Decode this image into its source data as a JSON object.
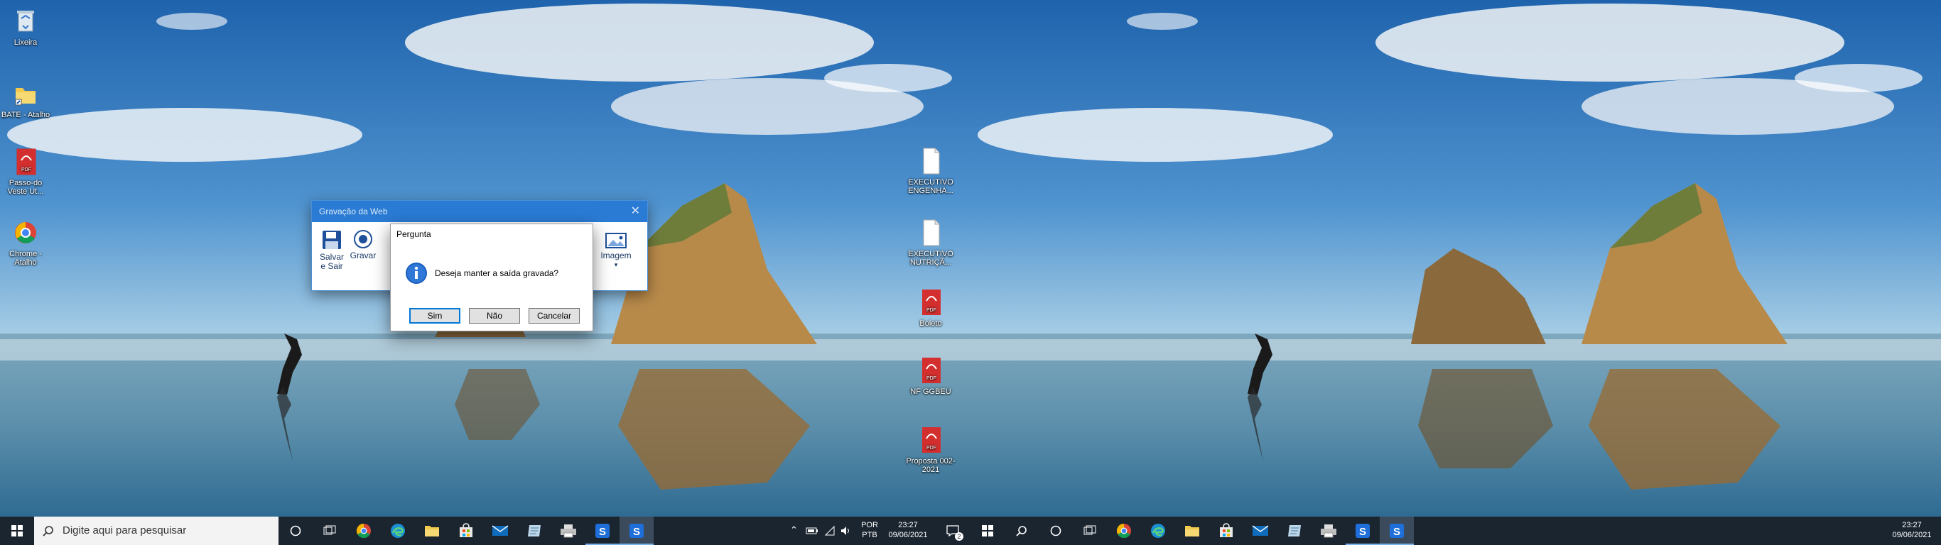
{
  "left_desktop": {
    "icons": [
      {
        "label": "Lixeira",
        "icon": "recycle-bin-icon"
      },
      {
        "label": "BATE - Atalho",
        "icon": "folder-shortcut-icon"
      },
      {
        "label": "Passo-do Veste Ut...",
        "icon": "pdf-file-icon"
      },
      {
        "label": "Chrome - Atalho",
        "icon": "chrome-icon"
      },
      {
        "label": "EXECUTIVO ENGENHA...",
        "icon": "blank-file-icon"
      },
      {
        "label": "EXECUTIVO NUTRIÇÃ...",
        "icon": "blank-file-icon"
      },
      {
        "label": "Boleto",
        "icon": "pdf-file-icon"
      },
      {
        "label": "NF GGBEU",
        "icon": "pdf-file-icon"
      },
      {
        "label": "Proposta 002-2021",
        "icon": "pdf-file-icon"
      }
    ]
  },
  "web_recorder": {
    "title": "Gravação da Web",
    "tools": {
      "save_exit": "Salvar\ne Sair",
      "record": "Gravar",
      "image": "Imagem"
    }
  },
  "dialog": {
    "title": "Pergunta",
    "message": "Deseja manter a saída gravada?",
    "buttons": {
      "yes": "Sim",
      "no": "Não",
      "cancel": "Cancelar"
    }
  },
  "taskbar_left": {
    "search_placeholder": "Digite aqui para pesquisar",
    "language": "POR",
    "layout": "PTB",
    "time": "23:27",
    "date": "09/06/2021",
    "notification_count": "2"
  },
  "taskbar_right": {
    "time": "23:27",
    "date": "09/06/2021"
  },
  "colors": {
    "accent": "#0078d7",
    "taskbar": "#1b2530",
    "titlebar": "#2a7bd4"
  }
}
